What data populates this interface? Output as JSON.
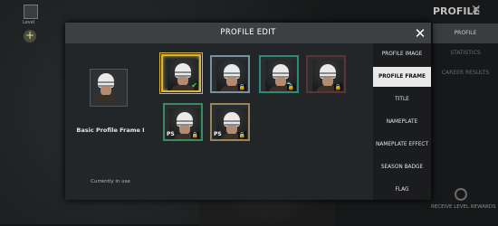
{
  "background": {
    "corner_label": "Level",
    "title": "PROFILE",
    "tabs": [
      "PROFILE",
      "STATISTICS",
      "CAREER RESULTS"
    ],
    "reward_label": "RECEIVE LEVEL REWARDS"
  },
  "modal": {
    "title": "PROFILE EDIT",
    "current_frame_name": "Basic Profile Frame I",
    "status": "Currently in use"
  },
  "frames": [
    {
      "style": "gold",
      "state": "equipped"
    },
    {
      "style": "blue",
      "state": "locked"
    },
    {
      "style": "teal",
      "state": "locked"
    },
    {
      "style": "red",
      "state": "locked"
    },
    {
      "style": "green",
      "badge": "PS",
      "state": "locked"
    },
    {
      "style": "tan",
      "badge": "PS",
      "state": "locked"
    }
  ],
  "menu": {
    "items": [
      "PROFILE IMAGE",
      "PROFILE FRAME",
      "TITLE",
      "NAMEPLATE",
      "NAMEPLATE EFFECT",
      "SEASON BADGE",
      "FLAG"
    ],
    "active_index": 1
  },
  "colors": {
    "accent": "#d8b43a",
    "modal_bg": "#232628",
    "menu_active_bg": "#e9e9e9"
  }
}
